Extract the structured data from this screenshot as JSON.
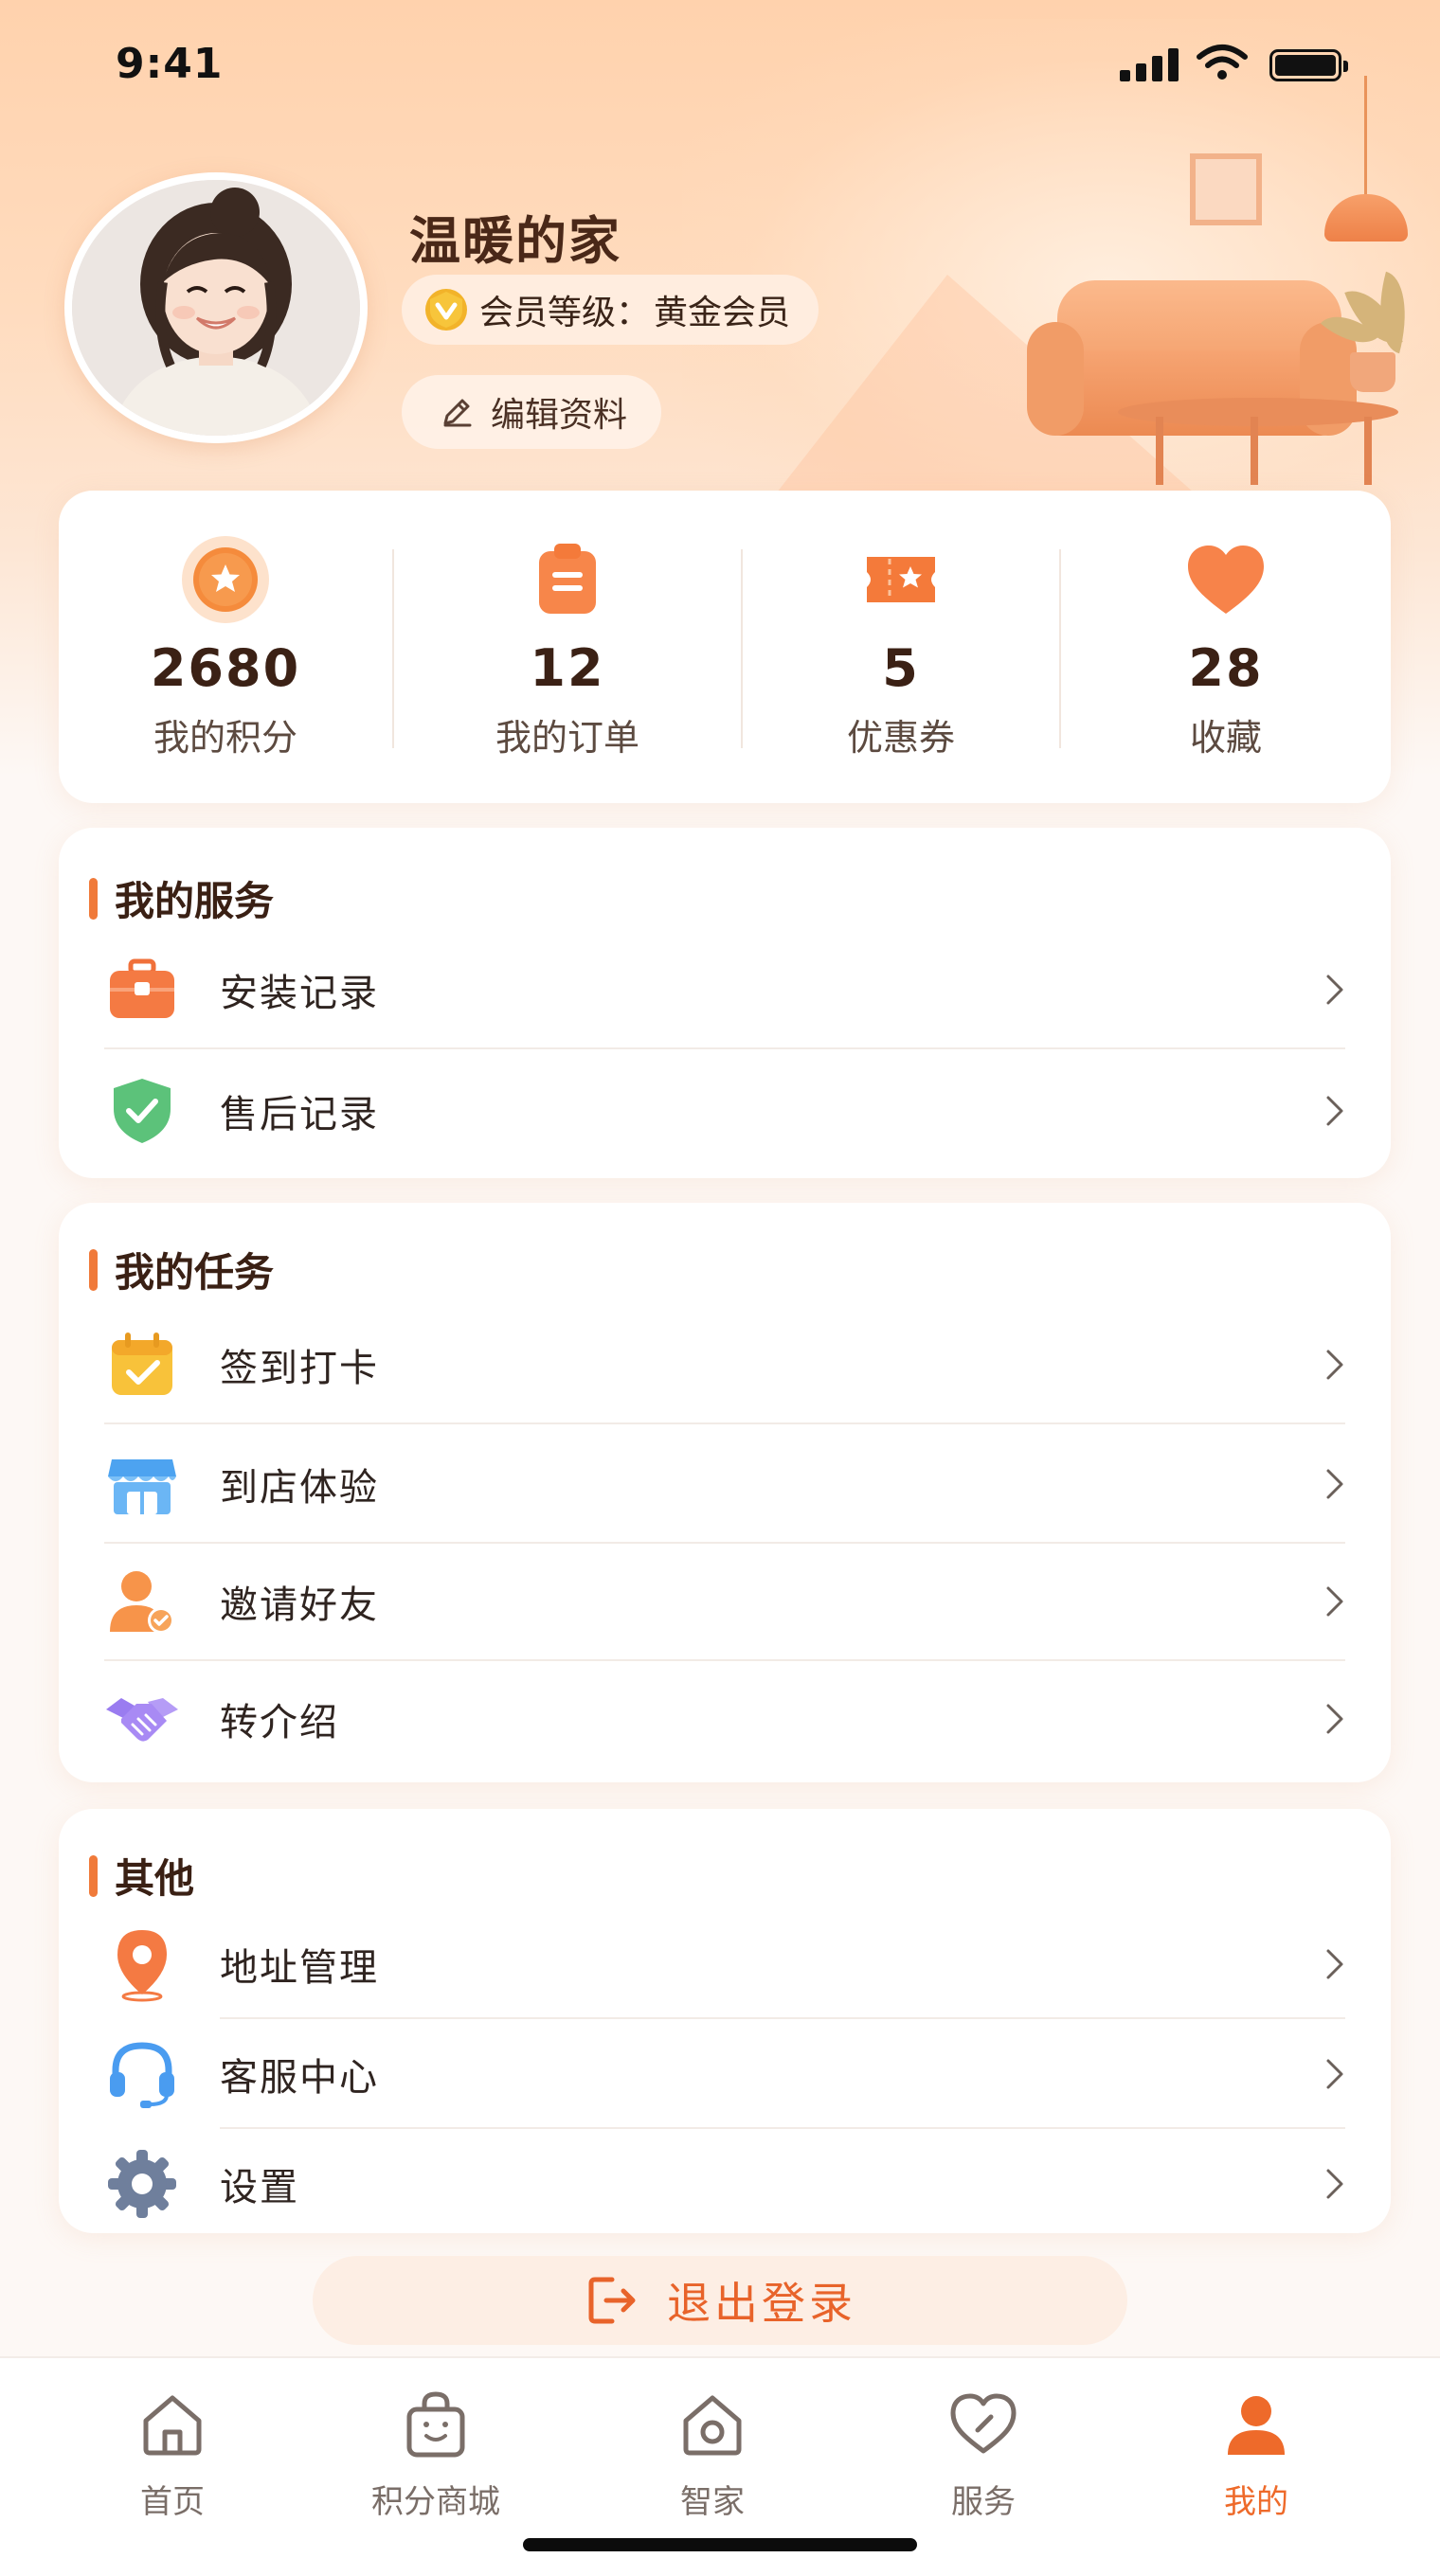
{
  "status_bar": {
    "time": "9:41"
  },
  "profile": {
    "name": "温暖的家",
    "member_level_label": "会员等级：",
    "member_level_value": "黄金会员",
    "edit_label": "编辑资料"
  },
  "stats": [
    {
      "value": "2680",
      "label": "我的积分",
      "icon": "points-star-icon"
    },
    {
      "value": "12",
      "label": "我的订单",
      "icon": "order-clipboard-icon"
    },
    {
      "value": "5",
      "label": "优惠券",
      "icon": "coupon-ticket-icon"
    },
    {
      "value": "28",
      "label": "收藏",
      "icon": "favorite-heart-icon"
    }
  ],
  "sections": {
    "services": {
      "title": "我的服务",
      "items": [
        {
          "label": "安装记录",
          "icon": "toolbox-icon"
        },
        {
          "label": "售后记录",
          "icon": "shield-check-icon"
        }
      ]
    },
    "tasks": {
      "title": "我的任务",
      "items": [
        {
          "label": "签到打卡",
          "icon": "calendar-check-icon"
        },
        {
          "label": "到店体验",
          "icon": "store-icon"
        },
        {
          "label": "邀请好友",
          "icon": "user-invite-icon"
        },
        {
          "label": "转介绍",
          "icon": "handshake-icon"
        }
      ]
    },
    "other": {
      "title": "其他",
      "items": [
        {
          "label": "地址管理",
          "icon": "location-pin-icon"
        },
        {
          "label": "客服中心",
          "icon": "headset-icon"
        },
        {
          "label": "设置",
          "icon": "gear-icon"
        }
      ]
    }
  },
  "logout_label": "退出登录",
  "tabs": [
    {
      "label": "首页",
      "icon": "home-icon",
      "active": false
    },
    {
      "label": "积分商城",
      "icon": "shopping-bag-icon",
      "active": false
    },
    {
      "label": "智家",
      "icon": "smart-home-icon",
      "active": false
    },
    {
      "label": "服务",
      "icon": "heart-service-icon",
      "active": false
    },
    {
      "label": "我的",
      "icon": "user-profile-icon",
      "active": true
    }
  ],
  "colors": {
    "accent": "#ee6a2a",
    "header_gradient_top": "#ffd2ad",
    "background": "#fdf8f5"
  }
}
